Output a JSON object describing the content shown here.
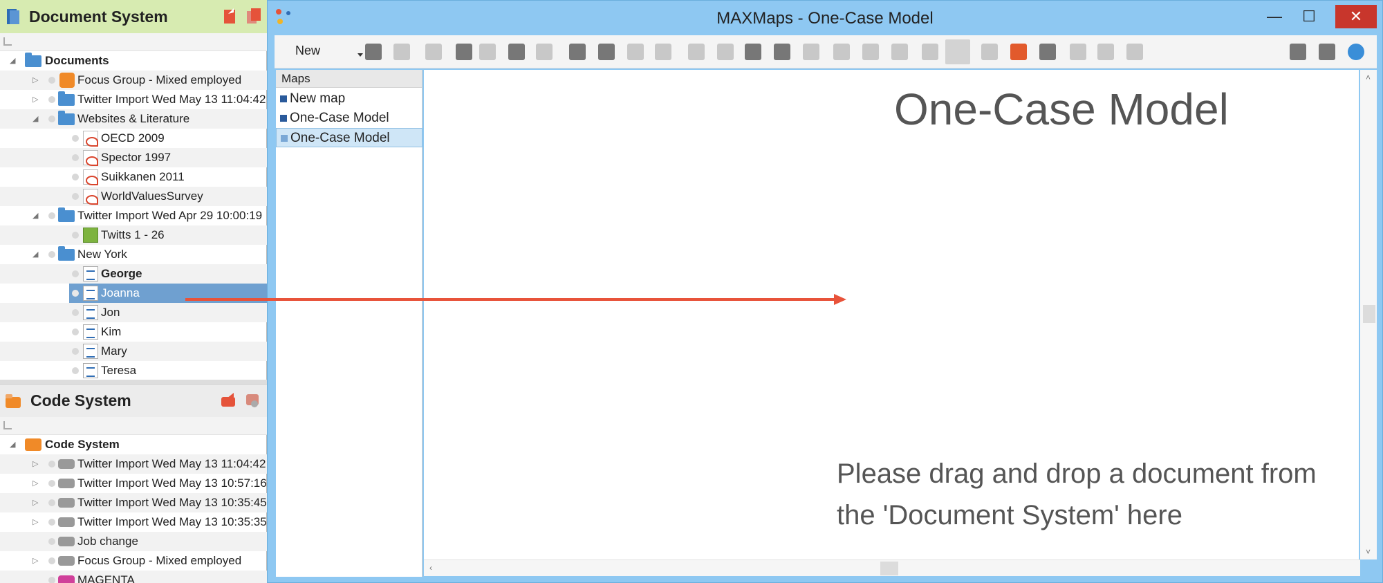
{
  "doc_system": {
    "title": "Document System",
    "rows": [
      {
        "label": "Documents",
        "bold": true,
        "icon": "folder-icon"
      },
      {
        "label": "Focus Group - Mixed employed",
        "icon": "focus-group-icon"
      },
      {
        "label": "Twitter Import Wed May 13 11:04:42",
        "icon": "folder-icon"
      },
      {
        "label": "Websites & Literature",
        "icon": "folder-icon"
      },
      {
        "label": "OECD 2009",
        "icon": "pdf-icon"
      },
      {
        "label": "Spector 1997",
        "icon": "pdf-icon"
      },
      {
        "label": "Suikkanen 2011",
        "icon": "pdf-icon"
      },
      {
        "label": "WorldValuesSurvey",
        "icon": "pdf-icon"
      },
      {
        "label": "Twitter Import Wed Apr 29 10:00:19",
        "icon": "folder-icon"
      },
      {
        "label": "Twitts 1 - 26",
        "icon": "spreadsheet-icon"
      },
      {
        "label": "New York",
        "icon": "folder-icon"
      },
      {
        "label": "George",
        "bold": true,
        "icon": "edit-text-icon"
      },
      {
        "label": "Joanna",
        "selected": true,
        "icon": "text-doc-icon"
      },
      {
        "label": "Jon",
        "icon": "text-doc-icon"
      },
      {
        "label": "Kim",
        "icon": "text-doc-icon"
      },
      {
        "label": "Mary",
        "icon": "text-doc-icon"
      },
      {
        "label": "Teresa",
        "icon": "text-doc-icon"
      }
    ]
  },
  "code_system": {
    "title": "Code System",
    "rows": [
      {
        "label": "Code System",
        "bold": true
      },
      {
        "label": "Twitter Import Wed May 13 11:04:42"
      },
      {
        "label": "Twitter Import Wed May 13 10:57:16"
      },
      {
        "label": "Twitter Import Wed May 13 10:35:45"
      },
      {
        "label": "Twitter Import Wed May 13 10:35:35"
      },
      {
        "label": "Job change"
      },
      {
        "label": "Focus Group - Mixed employed"
      },
      {
        "label": "MAGENTA"
      }
    ]
  },
  "window": {
    "title": "MAXMaps - One-Case Model",
    "minimize": "—",
    "maximize": "☐",
    "close": "✕"
  },
  "toolbar": {
    "new_label": "New"
  },
  "maps": {
    "header": "Maps",
    "items": [
      "New map",
      "One-Case Model",
      "One-Case Model"
    ]
  },
  "canvas": {
    "title": "One-Case Model",
    "hint": "Please drag and drop a document from the 'Document System' here"
  },
  "colors": {
    "accent_red": "#e8533a",
    "doc_header_bg": "#d7ebb1",
    "selection": "#6fa0d0",
    "window_frame": "#8ec8f2"
  }
}
